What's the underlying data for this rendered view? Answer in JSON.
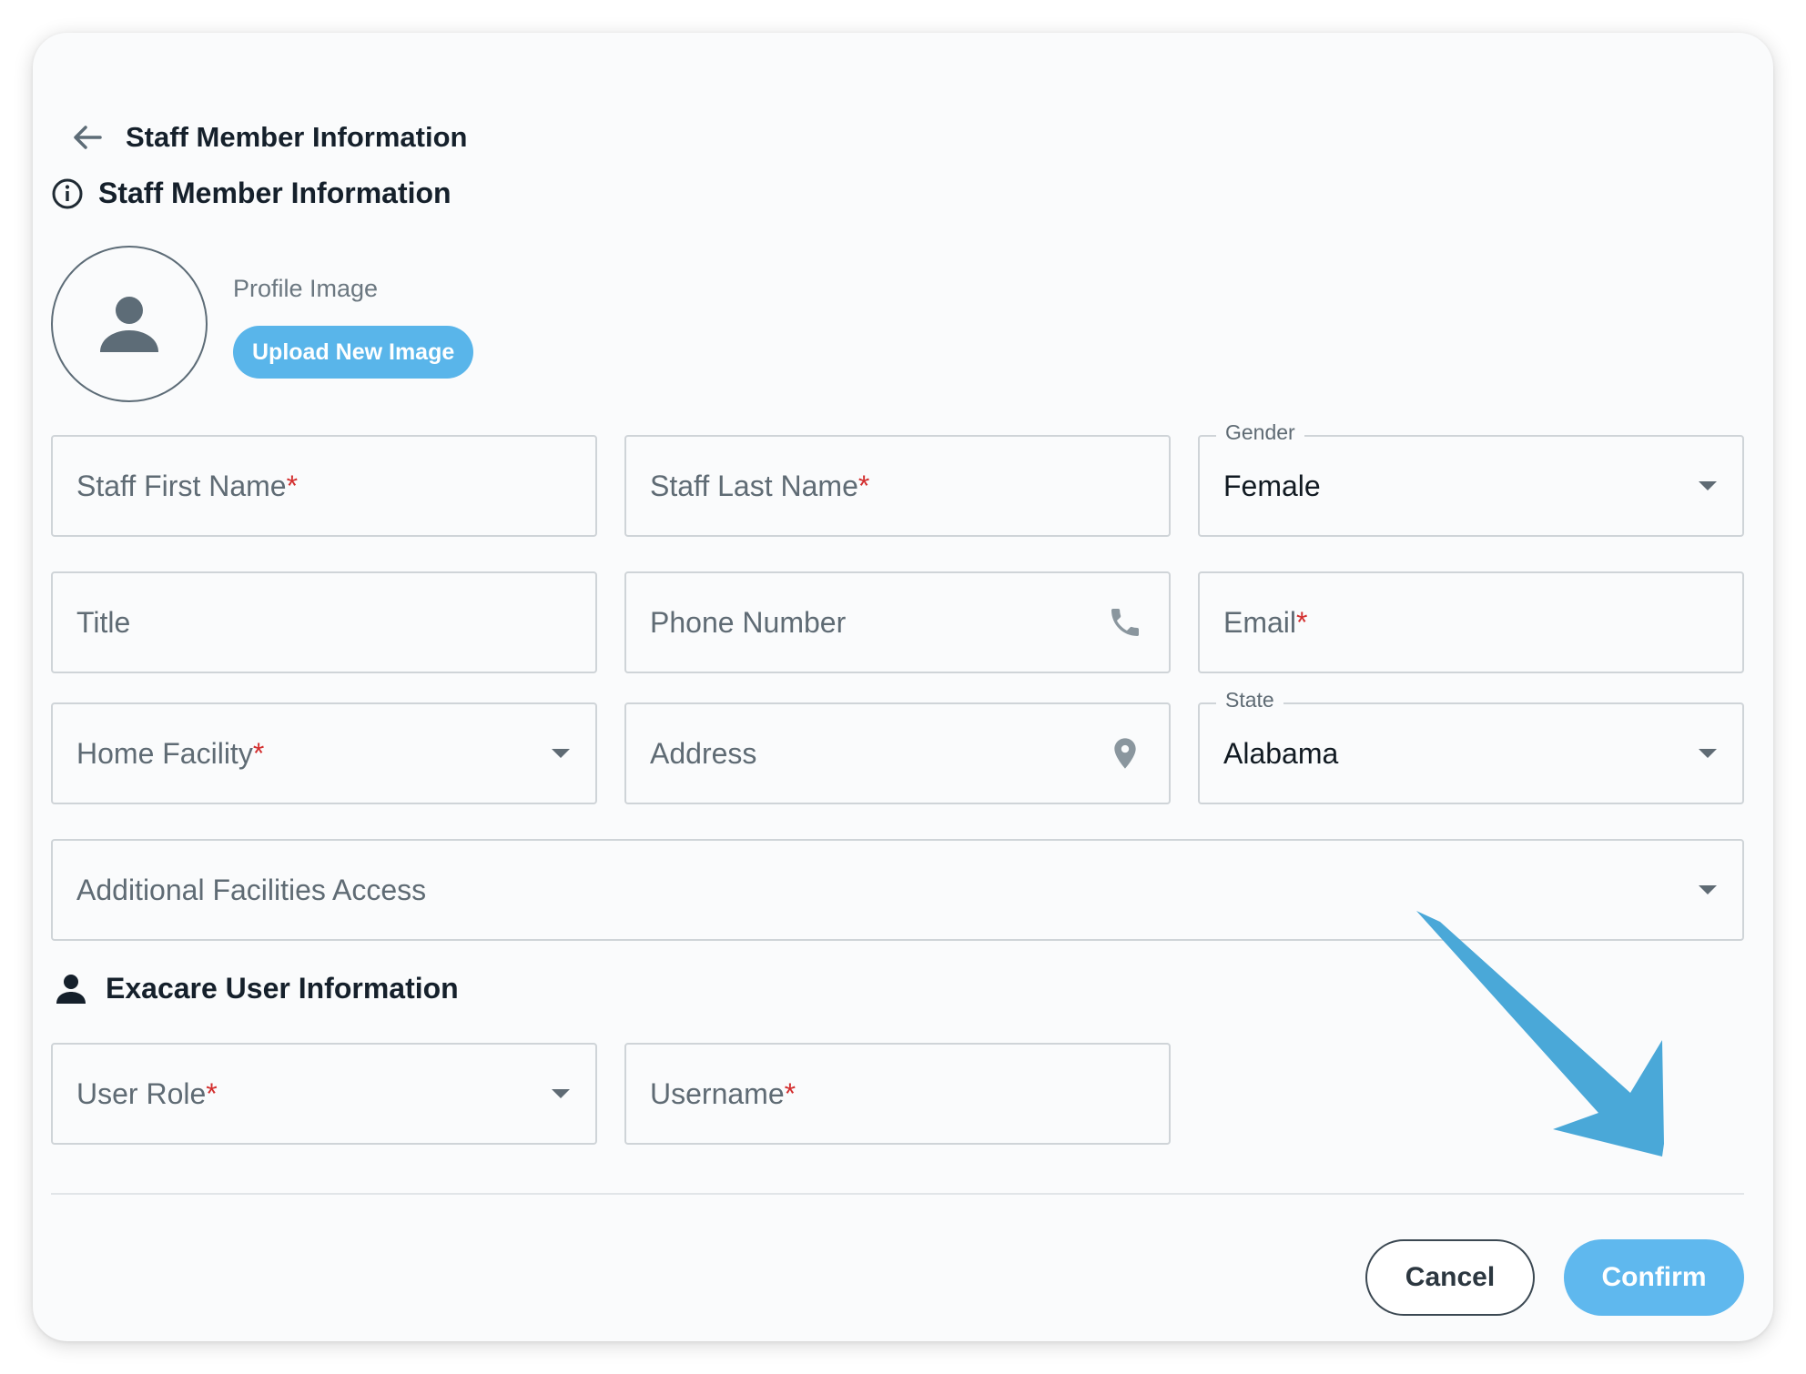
{
  "header": {
    "title": "Staff Member Information"
  },
  "section_staff": {
    "title": "Staff Member Information"
  },
  "profile": {
    "label": "Profile Image",
    "upload_label": "Upload New Image"
  },
  "fields": {
    "first_name": {
      "placeholder": "Staff First Name",
      "required": "*"
    },
    "last_name": {
      "placeholder": "Staff Last Name",
      "required": "*"
    },
    "gender": {
      "label": "Gender",
      "value": "Female"
    },
    "title": {
      "placeholder": "Title"
    },
    "phone": {
      "placeholder": "Phone Number"
    },
    "email": {
      "placeholder": "Email",
      "required": "*"
    },
    "home_facility": {
      "placeholder": "Home Facility",
      "required": "*"
    },
    "address": {
      "placeholder": "Address"
    },
    "state": {
      "label": "State",
      "value": "Alabama"
    },
    "additional_facilities": {
      "placeholder": "Additional Facilities Access"
    },
    "user_role": {
      "placeholder": "User Role",
      "required": "*"
    },
    "username": {
      "placeholder": "Username",
      "required": "*"
    }
  },
  "section_user": {
    "title": "Exacare User Information"
  },
  "actions": {
    "cancel_label": "Cancel",
    "confirm_label": "Confirm"
  },
  "icons": {
    "back": "arrow-left-icon",
    "info": "info-icon",
    "avatar": "person-icon",
    "phone": "phone-icon",
    "location": "location-pin-icon",
    "user": "person-icon",
    "dropdown": "caret-down-icon"
  },
  "colors": {
    "accent": "#59b5ea",
    "required": "#d32f2f",
    "annotation_arrow": "#4aa8d8"
  }
}
